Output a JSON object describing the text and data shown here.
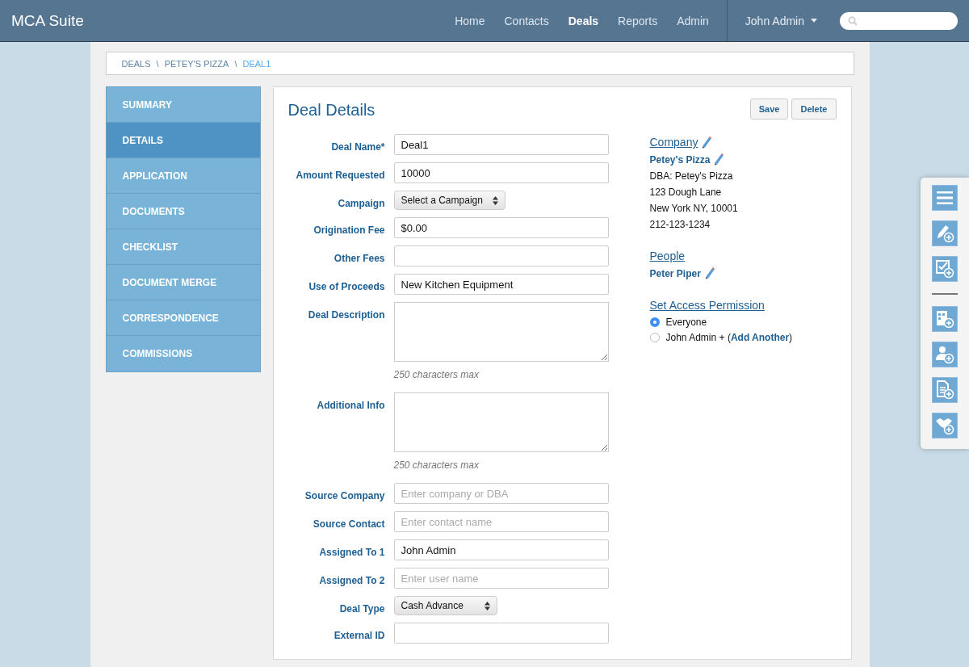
{
  "app": {
    "title": "MCA Suite"
  },
  "nav": [
    {
      "label": "Home",
      "selected": false
    },
    {
      "label": "Contacts",
      "selected": false
    },
    {
      "label": "Deals",
      "selected": true
    },
    {
      "label": "Reports",
      "selected": false
    },
    {
      "label": "Admin",
      "selected": false
    }
  ],
  "user_menu": {
    "label": "John Admin"
  },
  "breadcrumb": [
    {
      "label": "DEALS",
      "selected": false
    },
    {
      "label": "PETEY'S PIZZA",
      "selected": false
    },
    {
      "label": "DEAL1",
      "selected": true
    }
  ],
  "breadcrumb_separator": "\\",
  "sidebar": [
    {
      "label": "SUMMARY",
      "selected": false
    },
    {
      "label": "DETAILS",
      "selected": true
    },
    {
      "label": "APPLICATION",
      "selected": false
    },
    {
      "label": "DOCUMENTS",
      "selected": false
    },
    {
      "label": "CHECKLIST",
      "selected": false
    },
    {
      "label": "DOCUMENT MERGE",
      "selected": false
    },
    {
      "label": "CORRESPONDENCE",
      "selected": false
    },
    {
      "label": "COMMISSIONS",
      "selected": false
    }
  ],
  "panel": {
    "title": "Deal Details",
    "buttons": [
      "Save",
      "Delete"
    ]
  },
  "fields": [
    {
      "kind": "text",
      "label": "Deal Name*",
      "value": "Deal1"
    },
    {
      "kind": "text",
      "label": "Amount Requested",
      "value": "10000"
    },
    {
      "kind": "select",
      "label": "Campaign",
      "value": "Select a Campaign"
    },
    {
      "kind": "text",
      "label": "Origination Fee",
      "value": "$0.00"
    },
    {
      "kind": "text",
      "label": "Other Fees"
    },
    {
      "kind": "text",
      "label": "Use of Proceeds",
      "value": "New Kitchen Equipment"
    },
    {
      "kind": "textarea",
      "label": "Deal Description",
      "hint": "250 characters max"
    },
    {
      "kind": "textarea",
      "label": "Additional Info",
      "hint": "250 characters max"
    },
    {
      "kind": "text",
      "label": "Source Company",
      "placeholder": "Enter company or DBA"
    },
    {
      "kind": "text",
      "label": "Source Contact",
      "placeholder": "Enter contact name"
    },
    {
      "kind": "text",
      "label": "Assigned To 1",
      "value": "John Admin"
    },
    {
      "kind": "text",
      "label": "Assigned To 2",
      "placeholder": "Enter user name"
    },
    {
      "kind": "select",
      "label": "Deal Type",
      "value": "Cash Advance"
    },
    {
      "kind": "text",
      "label": "External ID"
    }
  ],
  "company": {
    "heading": "Company",
    "name": "Petey's Pizza",
    "lines": [
      "DBA: Petey's Pizza",
      "123 Dough Lane",
      "New York NY, 10001",
      "212-123-1234"
    ]
  },
  "people": {
    "heading": "People",
    "names": [
      "Peter Piper"
    ]
  },
  "access": {
    "heading": "Set Access Permission",
    "options": [
      {
        "label": "Everyone",
        "selected": true
      },
      {
        "label": "John Admin + (",
        "link": "Add Another",
        "suffix": ")",
        "selected": false
      }
    ]
  }
}
